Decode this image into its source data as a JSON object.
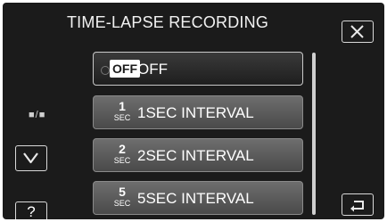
{
  "header": {
    "title": "TIME-LAPSE RECORDING"
  },
  "menu": {
    "items": [
      {
        "icon_text": "OFF",
        "label": "OFF",
        "selected": true
      },
      {
        "icon_num": "1",
        "icon_unit": "SEC",
        "label": "1SEC INTERVAL"
      },
      {
        "icon_num": "2",
        "icon_unit": "SEC",
        "label": "2SEC INTERVAL"
      },
      {
        "icon_num": "5",
        "icon_unit": "SEC",
        "label": "5SEC INTERVAL"
      }
    ]
  },
  "nav": {
    "page_indicator": "■/■",
    "help_label": "?"
  },
  "icons": {
    "close": "close-icon",
    "down": "chevron-down-icon",
    "back": "return-icon"
  }
}
